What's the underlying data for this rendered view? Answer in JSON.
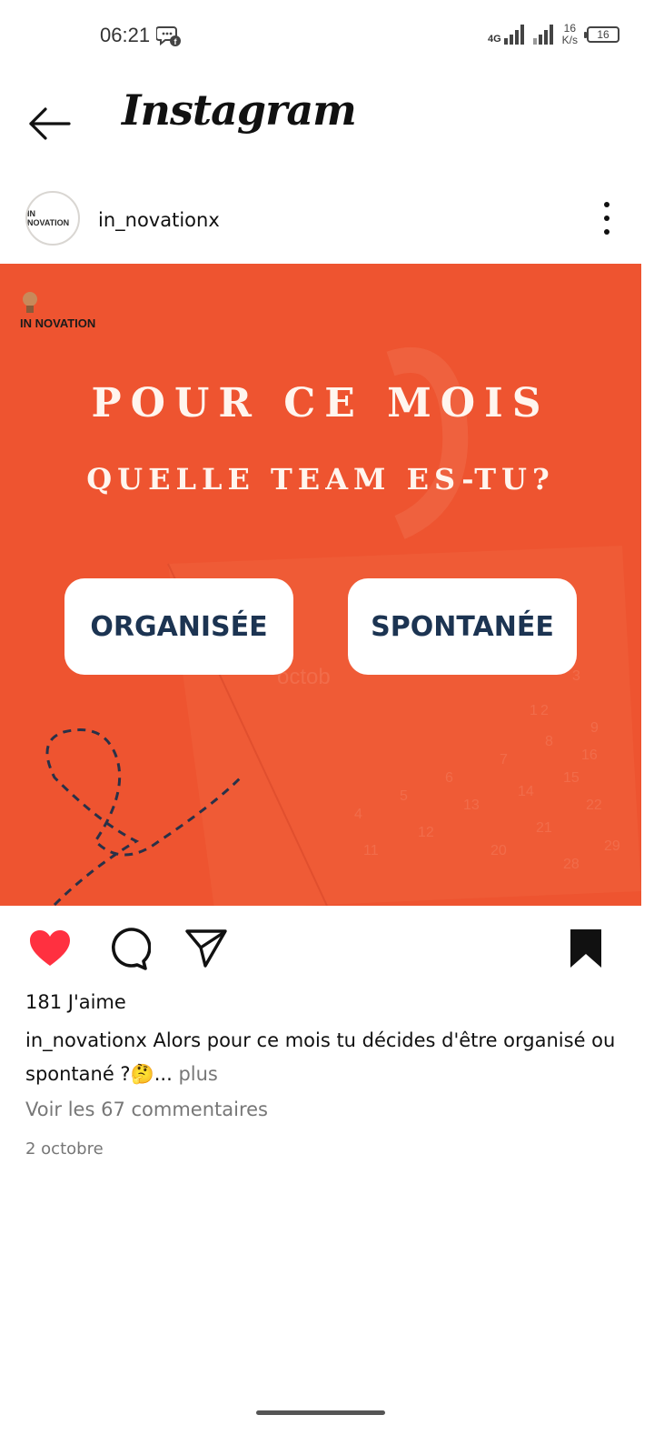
{
  "status_bar": {
    "time": "06:21",
    "network": "4G",
    "speed_value": "16",
    "speed_unit": "K/s",
    "battery": "16",
    "chat_icon": "messenger-facebook-notification-icon"
  },
  "header": {
    "title": "Instagram",
    "back_icon": "arrow-left-icon"
  },
  "post": {
    "username": "in_novationx",
    "avatar_text": "IN NOVATION",
    "more_icon": "vertical-ellipsis-icon",
    "image": {
      "logo_text": "IN NOVATION",
      "title": "POUR CE MOIS",
      "subtitle": "QUELLE TEAM ES-TU?",
      "choice_1": "ORGANISÉE",
      "choice_2": "SPONTANÉE",
      "background_color": "#ee5430"
    },
    "actions": {
      "like_icon": "heart-filled-icon",
      "comment_icon": "comment-bubble-icon",
      "share_icon": "paper-plane-icon",
      "save_icon": "bookmark-filled-icon",
      "like_color": "#ff3040"
    },
    "likes": "181 J'aime",
    "caption_user": "in_novationx",
    "caption_text": "Alors pour ce mois tu décides d'être organisé ou spontané ?🤔...",
    "caption_more": " plus",
    "comments_link": "Voir les 67 commentaires",
    "date": "2 octobre"
  }
}
